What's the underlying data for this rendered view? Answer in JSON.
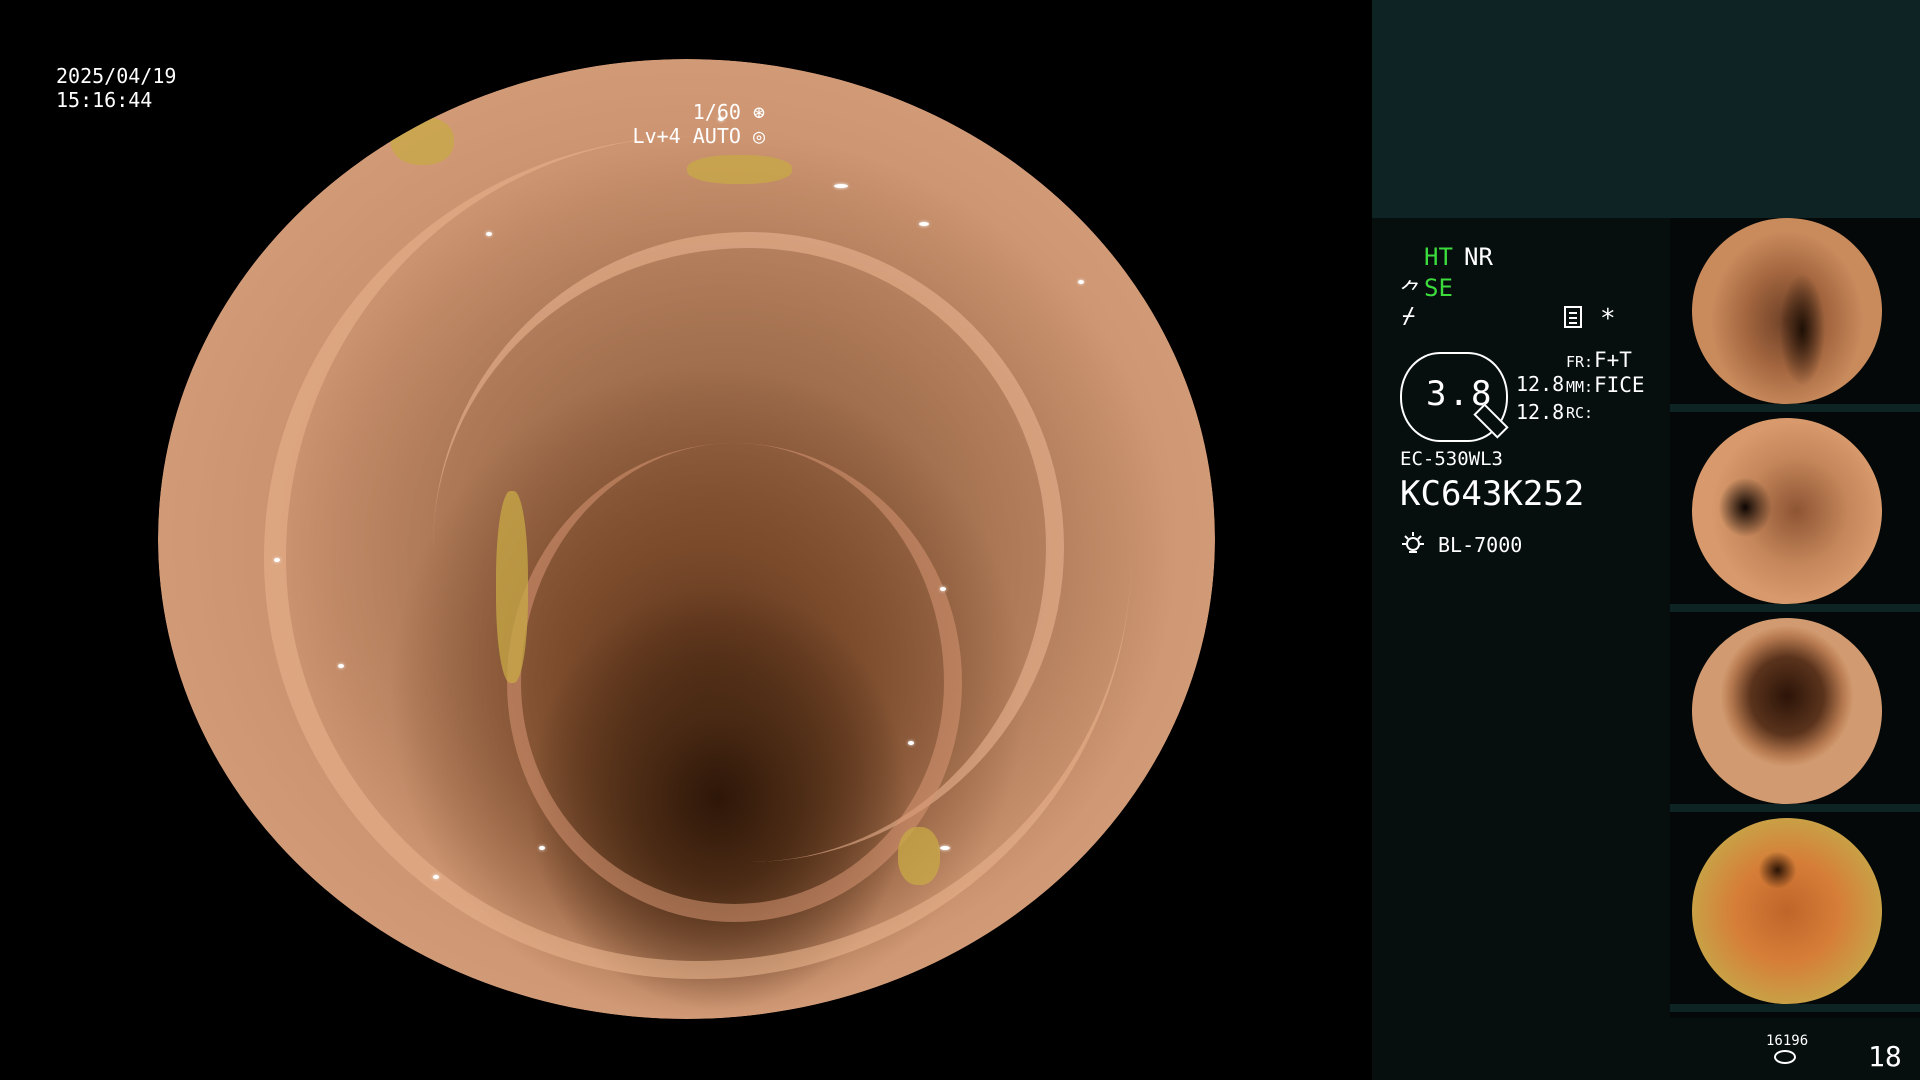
{
  "live_view": {
    "date": "2025/04/19",
    "time": "15:16:44",
    "shutter": "1/60",
    "iris": "Lv+4 AUTO"
  },
  "panel": {
    "modes": {
      "ht": "HT",
      "nr": "NR",
      "se": "SE"
    },
    "zoom_value": "3.8",
    "value_a": "12.8",
    "value_b": "12.8",
    "fr_label": "FR:",
    "fr_value": "F+T",
    "mm_label": "MM:",
    "mm_value": "FICE",
    "rc_label": "RC:",
    "scope_model": "EC-530WL3",
    "scope_serial": "KC643K252",
    "light_source": "BL-7000",
    "storage_count": "16196",
    "image_count": "18"
  },
  "colors": {
    "panel_bg": "#060e0e",
    "panel_header": "#0e2324",
    "mode_active": "#3ddc3d"
  }
}
